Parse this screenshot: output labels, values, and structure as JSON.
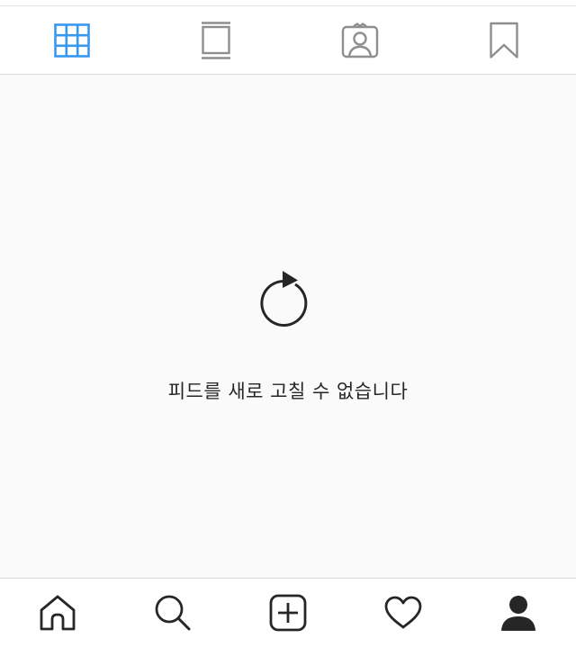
{
  "profile_tabs": {
    "items": [
      {
        "id": "grid",
        "icon": "grid-icon",
        "active": true
      },
      {
        "id": "igtv",
        "icon": "igtv-icon",
        "active": false
      },
      {
        "id": "tagged",
        "icon": "tagged-person-icon",
        "active": false
      },
      {
        "id": "saved",
        "icon": "bookmark-icon",
        "active": false
      }
    ],
    "active_color": "#3897f0",
    "inactive_color": "#8e8e8e"
  },
  "feed": {
    "refresh_icon": "refresh-icon",
    "error_message": "피드를 새로 고칠 수 없습니다"
  },
  "bottom_nav": {
    "items": [
      {
        "id": "home",
        "icon": "home-icon"
      },
      {
        "id": "search",
        "icon": "search-icon"
      },
      {
        "id": "new-post",
        "icon": "add-post-icon"
      },
      {
        "id": "activity",
        "icon": "heart-icon"
      },
      {
        "id": "profile",
        "icon": "profile-icon",
        "active": true
      }
    ],
    "icon_color": "#262626"
  }
}
